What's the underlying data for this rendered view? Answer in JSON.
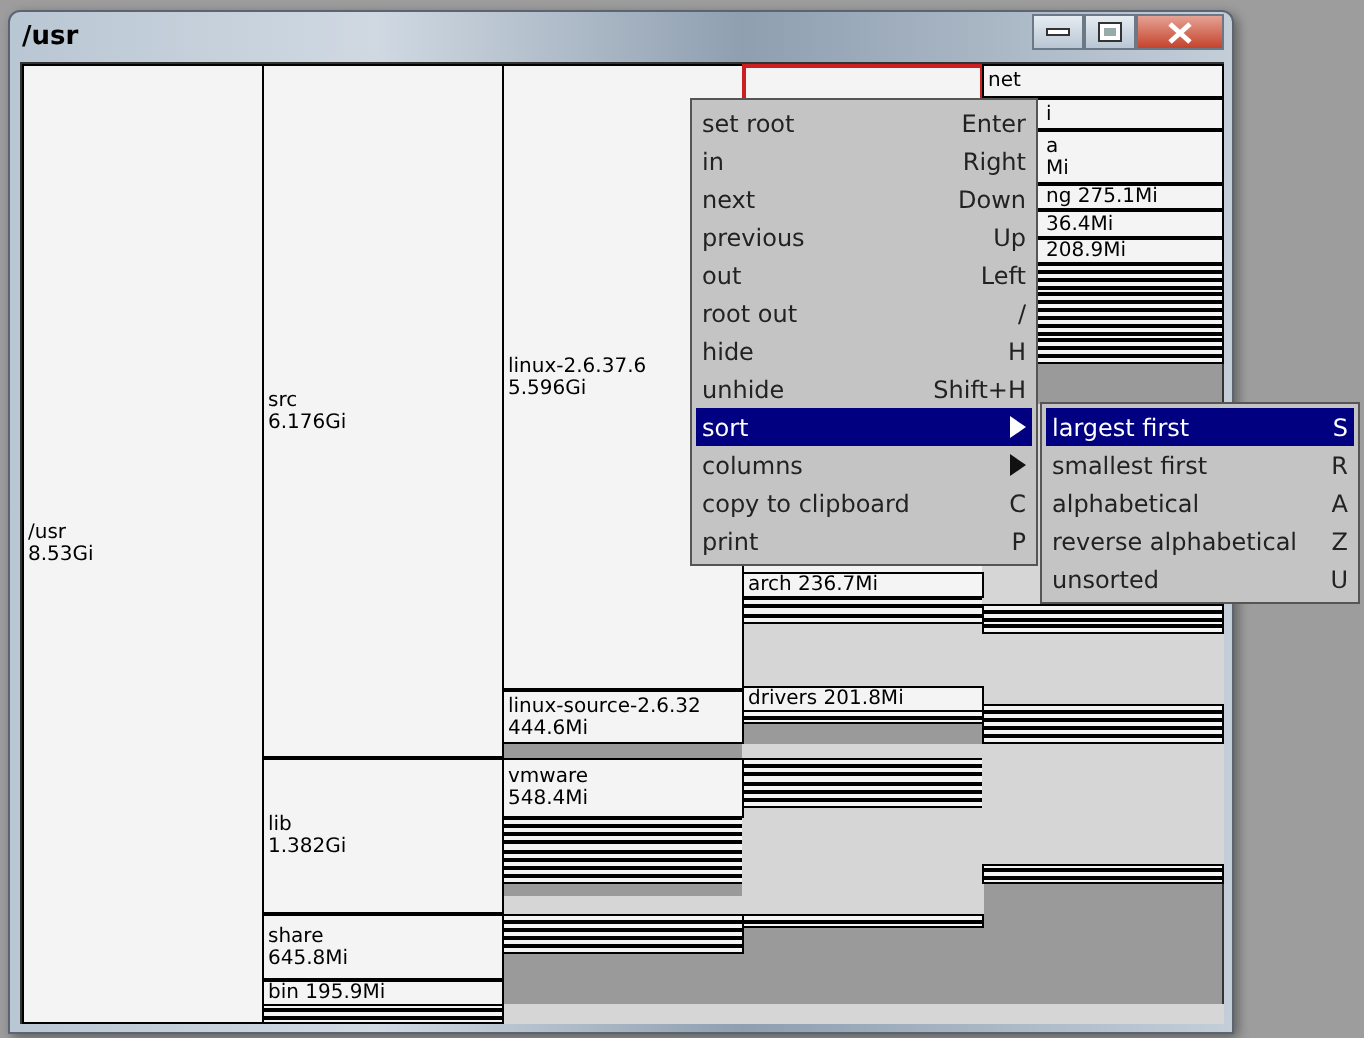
{
  "window": {
    "title": "/usr"
  },
  "treemap": {
    "columns": [
      {
        "cells": [
          {
            "lines": [
              "/usr",
              "8.53Gi"
            ],
            "selected": false
          }
        ]
      },
      {
        "cells": [
          {
            "lines": [
              "src",
              "6.176Gi"
            ],
            "selected": false
          },
          {
            "lines": [
              "lib",
              "1.382Gi"
            ],
            "selected": false
          },
          {
            "lines": [
              "share",
              "645.8Mi"
            ],
            "selected": false
          },
          {
            "lines": [
              "bin 195.9Mi"
            ],
            "selected": false
          }
        ]
      },
      {
        "cells": [
          {
            "lines": [
              "linux-2.6.37.6",
              "5.596Gi"
            ],
            "selected": false
          },
          {
            "lines": [
              "linux-source-2.6.32",
              "444.6Mi"
            ],
            "selected": false
          },
          {
            "lines": [
              "vmware",
              "548.4Mi"
            ],
            "selected": false
          }
        ]
      },
      {
        "cells": [
          {
            "selected": true
          },
          {
            "lines": [
              "arch 236.7Mi"
            ],
            "selected": false
          },
          {
            "lines": [
              "drivers 201.8Mi"
            ],
            "selected": false
          }
        ]
      },
      {
        "cells": [
          {
            "lines": [
              "net"
            ],
            "selected": false
          },
          {
            "lines": [
              "i"
            ],
            "selected": false
          },
          {
            "lines": [
              "a",
              "Mi"
            ],
            "selected": false
          },
          {
            "lines": [
              "ng 275.1Mi"
            ],
            "selected": false
          },
          {
            "lines": [
              "36.4Mi"
            ],
            "selected": false
          },
          {
            "lines": [
              "208.9Mi"
            ],
            "selected": false
          }
        ]
      }
    ]
  },
  "context_menu": {
    "items": [
      {
        "label": "set root",
        "shortcut": "Enter",
        "submenu": false,
        "selected": false
      },
      {
        "label": "in",
        "shortcut": "Right",
        "submenu": false,
        "selected": false
      },
      {
        "label": "next",
        "shortcut": "Down",
        "submenu": false,
        "selected": false
      },
      {
        "label": "previous",
        "shortcut": "Up",
        "submenu": false,
        "selected": false
      },
      {
        "label": "out",
        "shortcut": "Left",
        "submenu": false,
        "selected": false
      },
      {
        "label": "root out",
        "shortcut": "/",
        "submenu": false,
        "selected": false
      },
      {
        "label": "hide",
        "shortcut": "H",
        "submenu": false,
        "selected": false
      },
      {
        "label": "unhide",
        "shortcut": "Shift+H",
        "submenu": false,
        "selected": false
      },
      {
        "label": "sort",
        "submenu": true,
        "selected": true
      },
      {
        "label": "columns",
        "submenu": true,
        "selected": false
      },
      {
        "label": "copy to clipboard",
        "shortcut": "C",
        "submenu": false,
        "selected": false
      },
      {
        "label": "print",
        "shortcut": "P",
        "submenu": false,
        "selected": false
      }
    ]
  },
  "submenu": {
    "items": [
      {
        "label": "largest first",
        "shortcut": "S",
        "selected": true
      },
      {
        "label": "smallest first",
        "shortcut": "R",
        "selected": false
      },
      {
        "label": "alphabetical",
        "shortcut": "A",
        "selected": false
      },
      {
        "label": "reverse alphabetical",
        "shortcut": "Z",
        "selected": false
      },
      {
        "label": "unsorted",
        "shortcut": "U",
        "selected": false
      }
    ]
  }
}
